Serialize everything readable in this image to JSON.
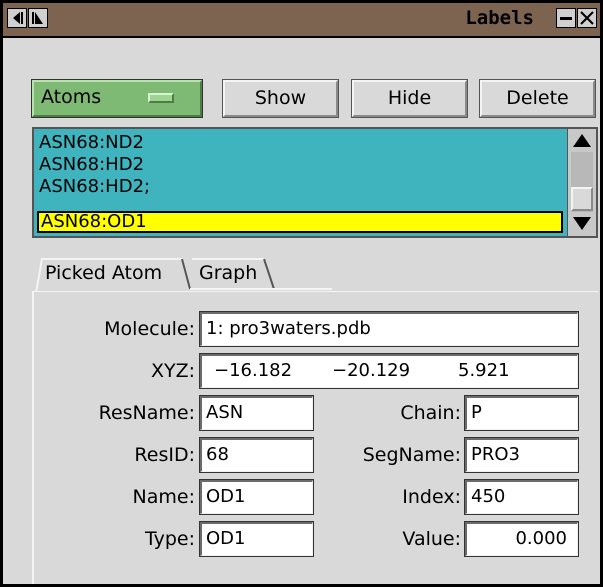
{
  "window": {
    "title": "Labels"
  },
  "toolbar": {
    "category": "Atoms",
    "show_label": "Show",
    "hide_label": "Hide",
    "delete_label": "Delete"
  },
  "list": {
    "items": [
      "ASN68:ND2",
      "ASN68:HD2",
      "ASN68:HD2;",
      "ASN68:OD1"
    ],
    "selected_index": 3
  },
  "tabs": [
    "Picked Atom",
    "Graph"
  ],
  "picked_atom": {
    "molecule_label": "Molecule:",
    "molecule_value": "1: pro3waters.pdb",
    "xyz_label": "XYZ:",
    "x": "−16.182",
    "y": "−20.129",
    "z": "5.921",
    "resname_label": "ResName:",
    "resname_value": "ASN",
    "resid_label": "ResID:",
    "resid_value": "68",
    "name_label": "Name:",
    "name_value": "OD1",
    "type_label": "Type:",
    "type_value": "OD1",
    "chain_label": "Chain:",
    "chain_value": "P",
    "segname_label": "SegName:",
    "segname_value": "PRO3",
    "index_label": "Index:",
    "index_value": "450",
    "value_label": "Value:",
    "value_value": "0.000"
  },
  "colors": {
    "titlebar": "#7c6450",
    "list_bg": "#3fb3be",
    "selection": "#ffff00",
    "menu_green": "#7fba74"
  }
}
